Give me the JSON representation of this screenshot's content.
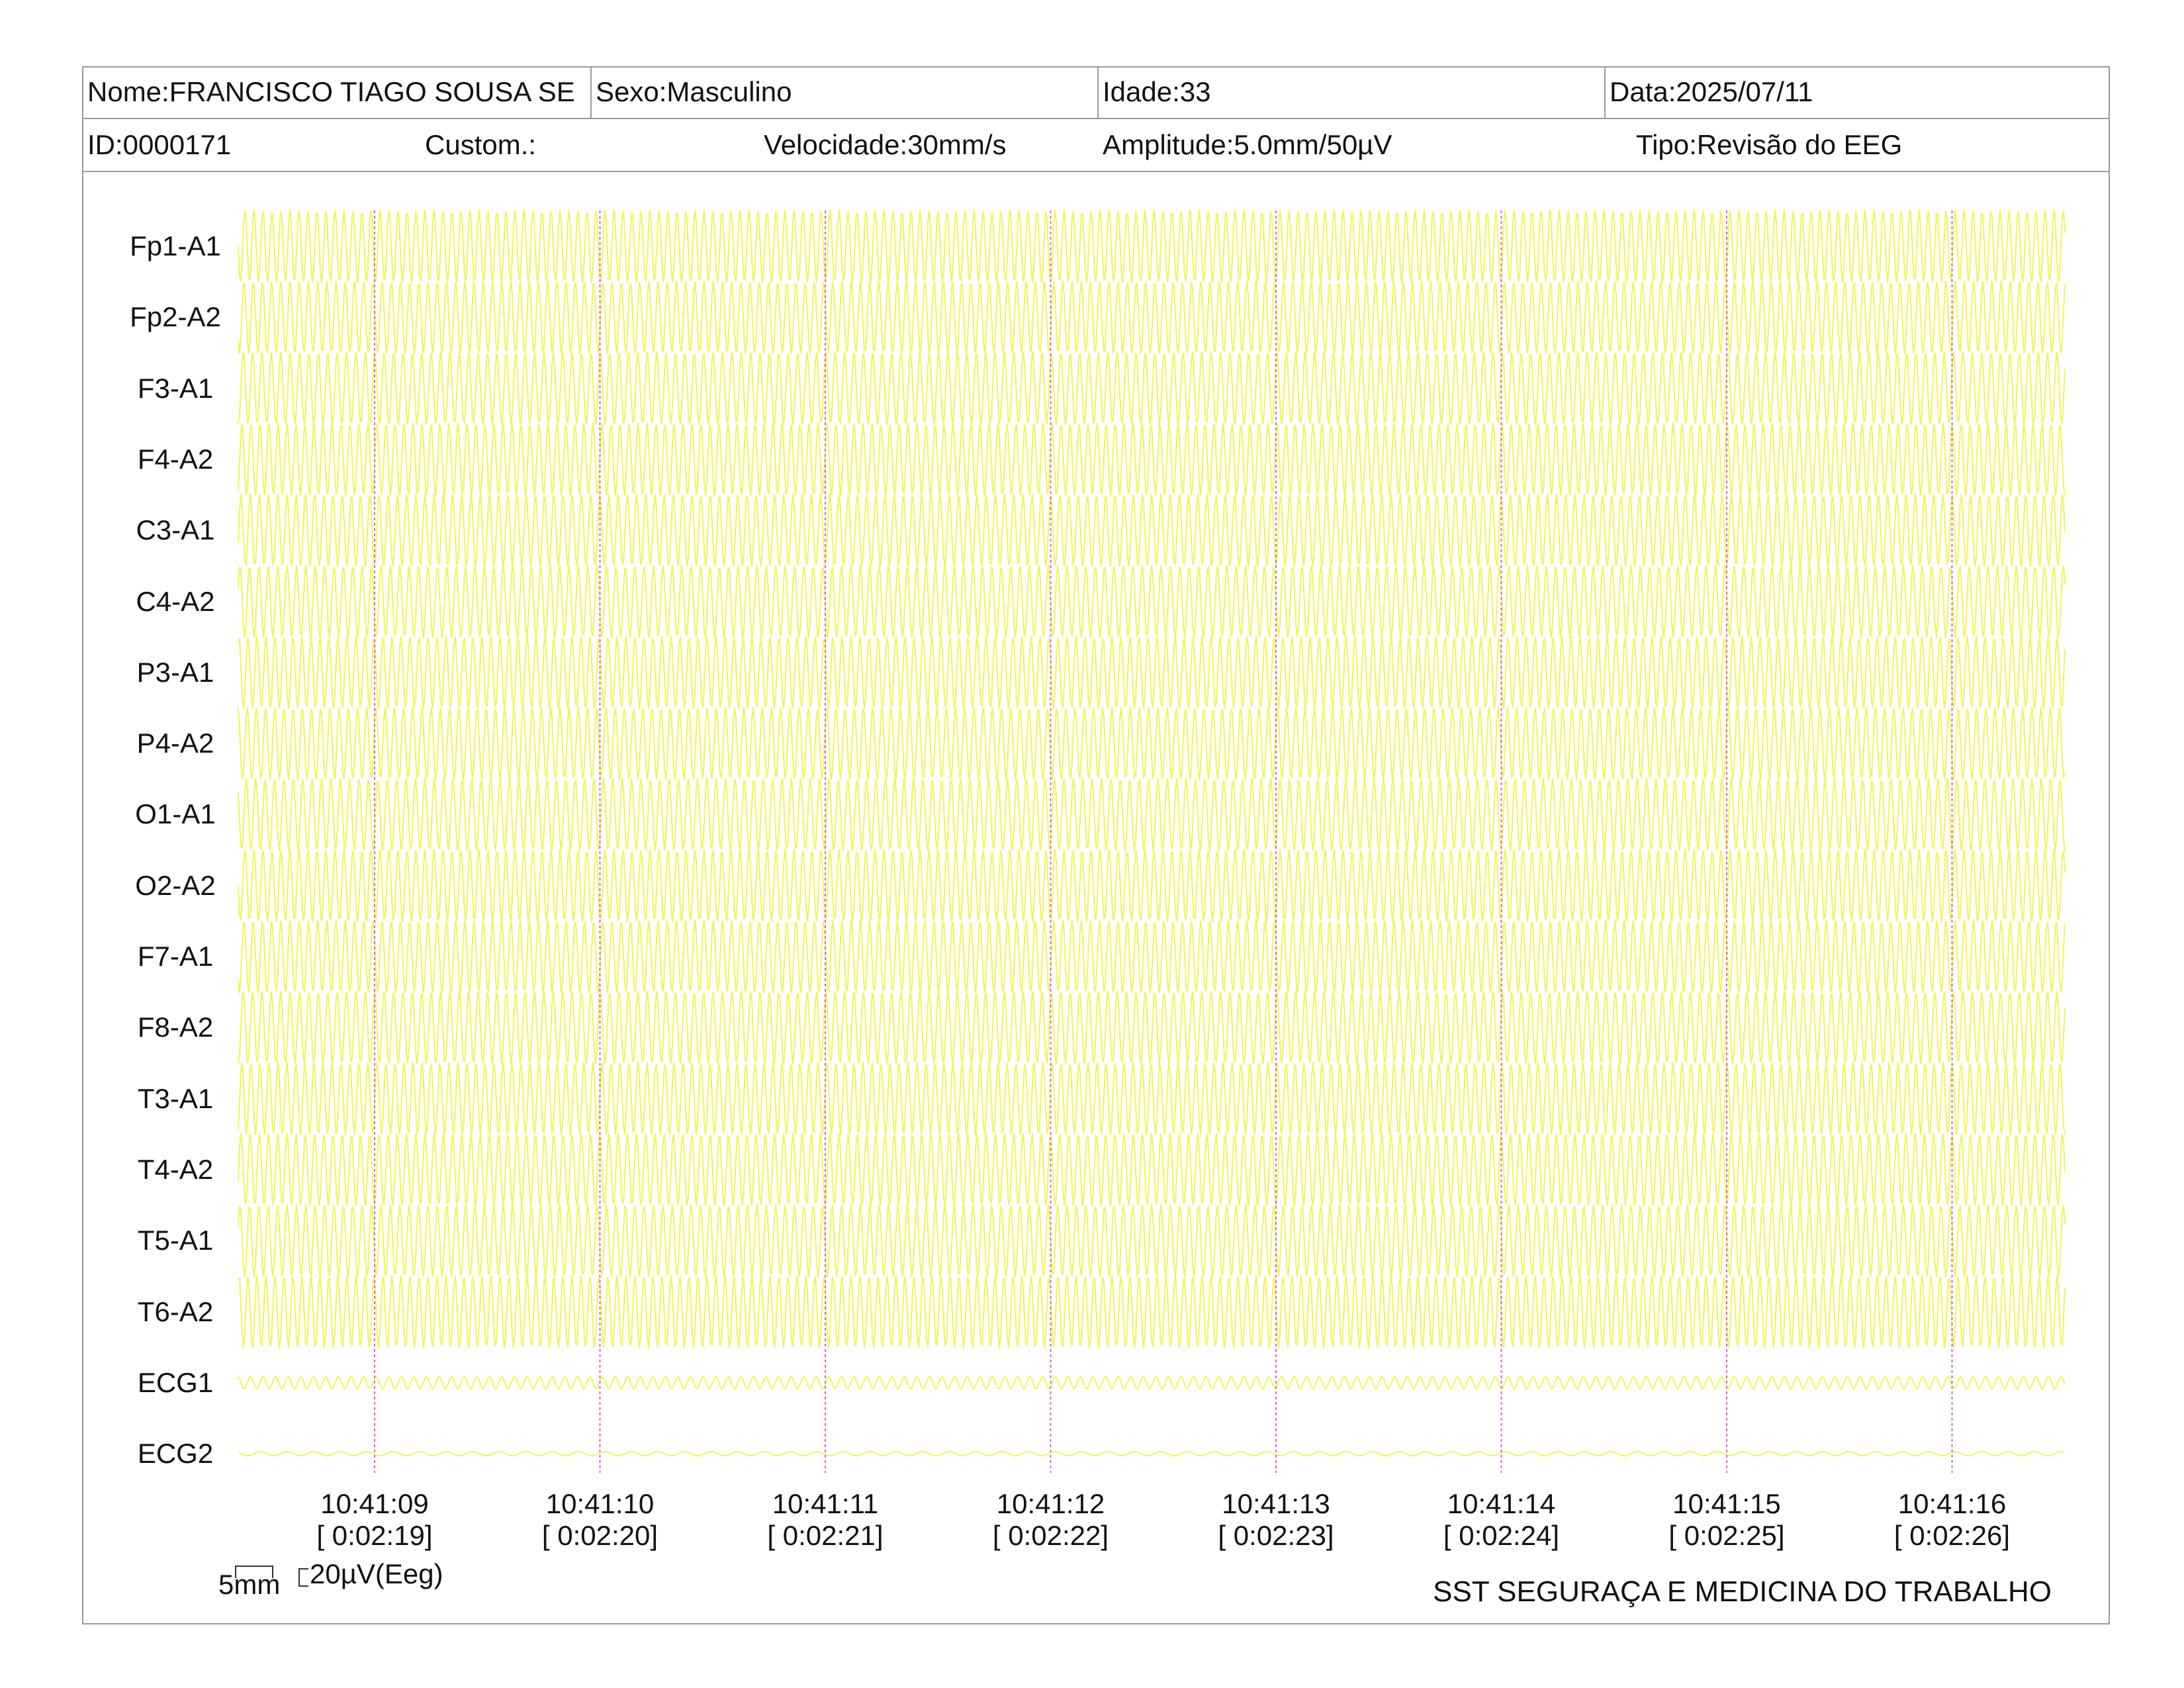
{
  "header": {
    "name": "Nome:FRANCISCO TIAGO SOUSA SE",
    "sex": "Sexo:Masculino",
    "age": "Idade:33",
    "date": "Data:2025/07/11",
    "id": "ID:0000171",
    "custom": "Custom.:",
    "speed": "Velocidade:30mm/s",
    "amplitude": "Amplitude:5.0mm/50µV",
    "type": "Tipo:Revisão do EEG"
  },
  "channels": [
    "Fp1-A1",
    "Fp2-A2",
    "F3-A1",
    "F4-A2",
    "C3-A1",
    "C4-A2",
    "P3-A1",
    "P4-A2",
    "O1-A1",
    "O2-A2",
    "F7-A1",
    "F8-A2",
    "T3-A1",
    "T4-A2",
    "T5-A1",
    "T6-A2",
    "ECG1",
    "ECG2"
  ],
  "timestamps": [
    {
      "time": "10:41:09",
      "elapsed": "[ 0:02:19]"
    },
    {
      "time": "10:41:10",
      "elapsed": "[ 0:02:20]"
    },
    {
      "time": "10:41:11",
      "elapsed": "[ 0:02:21]"
    },
    {
      "time": "10:41:12",
      "elapsed": "[ 0:02:22]"
    },
    {
      "time": "10:41:13",
      "elapsed": "[ 0:02:23]"
    },
    {
      "time": "10:41:14",
      "elapsed": "[ 0:02:24]"
    },
    {
      "time": "10:41:15",
      "elapsed": "[ 0:02:25]"
    },
    {
      "time": "10:41:16",
      "elapsed": "[ 0:02:26]"
    }
  ],
  "scale": {
    "length": "5mm",
    "amplitude": "20µV(Eeg)"
  },
  "footer": "SST SEGURAÇA E MEDICINA DO TRABALHO",
  "colors": {
    "trace": "#f2f24a",
    "time_marker": "#d060d0",
    "border": "#9a9a9a",
    "background": "#ffffff"
  }
}
